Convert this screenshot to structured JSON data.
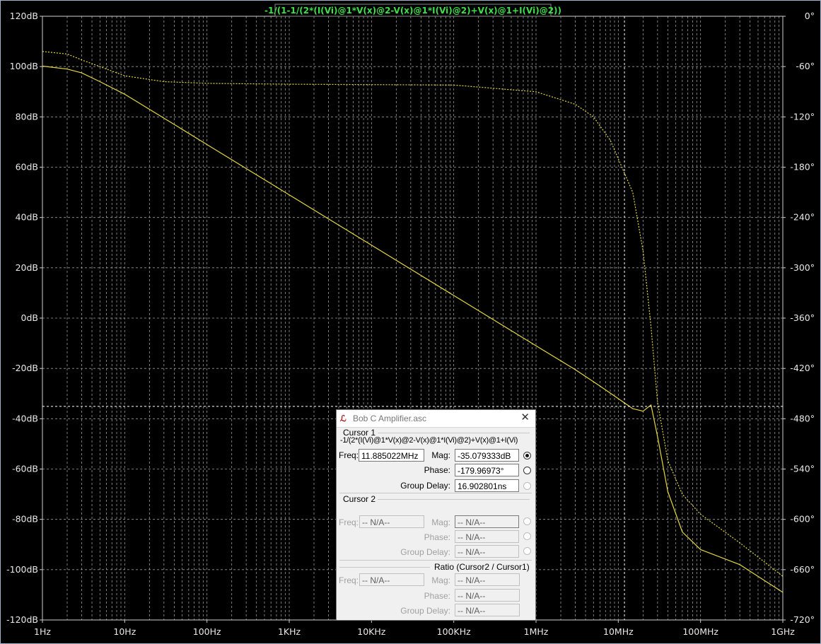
{
  "trace_expression": "-1/(1-1/(2*(I(Vi)@1*V(x)@2-V(x)@1*I(Vi)@2)+V(x)@1+I(Vi)@2))",
  "colors": {
    "background": "#000000",
    "grid": "#9a9a9a",
    "trace": "#e6d83c",
    "label": "#3ee04a"
  },
  "chart_data": {
    "type": "line",
    "title": "-1/(1-1/(2*(I(Vi)@1*V(x)@2-V(x)@1*I(Vi)@2)+V(x)@1+I(Vi)@2))",
    "xscale": "log",
    "xlim": [
      1,
      1000000000
    ],
    "x_ticks": [
      "1Hz",
      "10Hz",
      "100Hz",
      "1KHz",
      "10KHz",
      "100KHz",
      "1MHz",
      "10MHz",
      "100MHz",
      "1GHz"
    ],
    "ylim_left": [
      -120,
      120
    ],
    "y_ticks_left": [
      "120dB",
      "100dB",
      "80dB",
      "60dB",
      "40dB",
      "20dB",
      "0dB",
      "-20dB",
      "-40dB",
      "-60dB",
      "-80dB",
      "-100dB",
      "-120dB"
    ],
    "ylim_right": [
      -720,
      0
    ],
    "y_ticks_right": [
      "0°",
      "-60°",
      "-120°",
      "-180°",
      "-240°",
      "-300°",
      "-360°",
      "-420°",
      "-480°",
      "-540°",
      "-600°",
      "-660°",
      "-720°"
    ],
    "grid": true,
    "series": [
      {
        "axis": "left",
        "style": "solid",
        "x": [
          1,
          2,
          3,
          5,
          10,
          30,
          100,
          1000,
          10000,
          100000,
          1000000,
          3000000,
          6000000,
          10000000,
          15000000,
          20000000,
          25000000,
          30000000,
          40000000,
          60000000,
          100000000,
          300000000,
          1000000000
        ],
        "y": [
          100.2,
          99,
          97.5,
          94,
          89,
          79.5,
          69,
          49,
          29,
          9,
          -11,
          -20.5,
          -27,
          -32,
          -36,
          -37,
          -34.5,
          -47,
          -69,
          -85,
          -92,
          -98,
          -109
        ]
      },
      {
        "axis": "right",
        "style": "dashed",
        "x": [
          1,
          2,
          3,
          5,
          10,
          30,
          100,
          1000,
          10000,
          100000,
          1000000,
          3000000,
          5000000,
          8000000,
          10000000,
          15000000,
          20000000,
          25000000,
          30000000,
          40000000,
          60000000,
          100000000,
          300000000,
          1000000000
        ],
        "y": [
          -42,
          -45,
          -52,
          -60,
          -71,
          -78,
          -80,
          -81,
          -81.5,
          -82,
          -90,
          -105,
          -120,
          -148,
          -170,
          -210,
          -280,
          -370,
          -460,
          -530,
          -570,
          -594,
          -628,
          -668
        ]
      }
    ],
    "cursor": {
      "freq": 11885022,
      "mag": -35.079333
    }
  },
  "dialog": {
    "title": "Bob C Amplifier.asc",
    "close": "✕",
    "cursor1": {
      "group": "Cursor 1",
      "expression": "-1/(2*(I(Vi)@1*V(x)@2-V(x)@1*I(Vi)@2)+V(x)@1+I(Vi)",
      "freq_label": "Freq:",
      "freq": "11.885022MHz",
      "mag_label": "Mag:",
      "mag": "-35.079333dB",
      "phase_label": "Phase:",
      "phase": "-179.96973°",
      "gd_label": "Group Delay:",
      "gd": "16.902801ns"
    },
    "cursor2": {
      "group": "Cursor 2",
      "freq_label": "Freq:",
      "freq": "-- N/A--",
      "mag_label": "Mag:",
      "mag": "-- N/A--",
      "phase_label": "Phase:",
      "phase": "-- N/A--",
      "gd_label": "Group Delay:",
      "gd": "-- N/A--"
    },
    "ratio": {
      "group": "Ratio (Cursor2 / Cursor1)",
      "freq_label": "Freq:",
      "freq": "-- N/A--",
      "mag_label": "Mag:",
      "mag": "-- N/A--",
      "phase_label": "Phase:",
      "phase": "-- N/A--",
      "gd_label": "Group Delay:",
      "gd": "-- N/A--"
    }
  }
}
